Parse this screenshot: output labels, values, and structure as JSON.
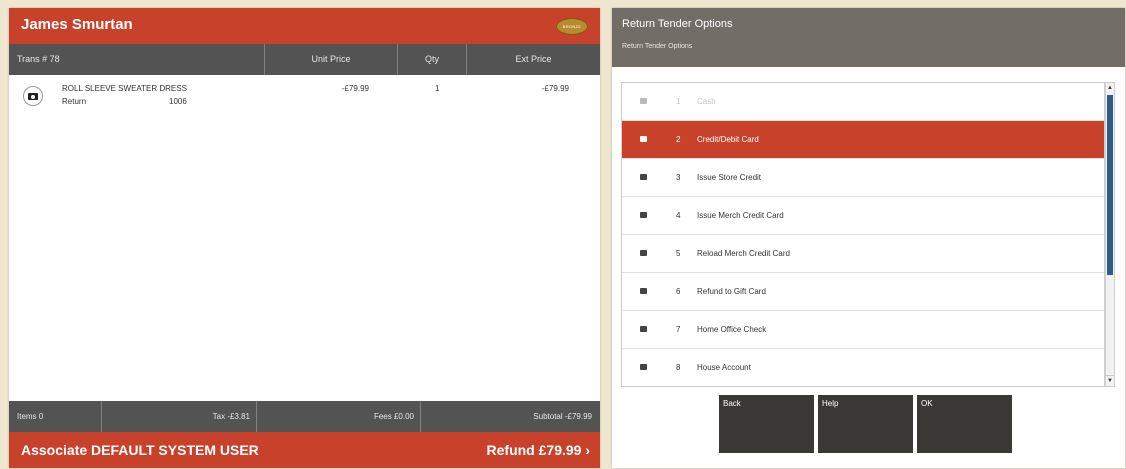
{
  "customer": {
    "name": "James Smurtan",
    "badge_text": "BRONZE"
  },
  "table_header": {
    "trans": "Trans # 78",
    "unit_price": "Unit Price",
    "qty": "Qty",
    "ext_price": "Ext Price"
  },
  "item": {
    "icon": "camera-icon",
    "description": "ROLL SLEEVE SWEATER DRESS",
    "type": "Return",
    "sku": "1006",
    "unit_price": "-£79.99",
    "qty": "1",
    "ext_price": "-£79.99"
  },
  "totals": {
    "items": "Items 0",
    "tax": "Tax -£3.81",
    "fees": "Fees £0.00",
    "subtotal": "Subtotal -£79.99"
  },
  "footer": {
    "associate": "Associate DEFAULT SYSTEM USER",
    "refund": "Refund £79.99 ›"
  },
  "return_tender": {
    "title": "Return Tender Options",
    "subtitle": "Return Tender Options",
    "options": [
      {
        "num": "1",
        "label": "Cash",
        "icon": "cash-icon",
        "state": "disabled"
      },
      {
        "num": "2",
        "label": "Credit/Debit Card",
        "icon": "credit-card-icon",
        "state": "selected"
      },
      {
        "num": "3",
        "label": "Issue Store Credit",
        "icon": "store-credit-icon",
        "state": "normal"
      },
      {
        "num": "4",
        "label": "Issue Merch Credit Card",
        "icon": "merch-card-icon",
        "state": "normal"
      },
      {
        "num": "5",
        "label": "Reload Merch Credit Card",
        "icon": "reload-card-icon",
        "state": "normal"
      },
      {
        "num": "6",
        "label": "Refund to Gift Card",
        "icon": "gift-card-icon",
        "state": "normal"
      },
      {
        "num": "7",
        "label": "Home Office Check",
        "icon": "check-icon",
        "state": "normal"
      },
      {
        "num": "8",
        "label": "House Account",
        "icon": "house-account-icon",
        "state": "normal"
      }
    ],
    "buttons": {
      "back": "Back",
      "help": "Help",
      "ok": "OK"
    }
  },
  "colors": {
    "accent": "#c8422b",
    "header_gray": "#535353",
    "button_dark": "#3a3835",
    "scroll_thumb": "#2f5c8a",
    "background": "#efe6cf"
  }
}
